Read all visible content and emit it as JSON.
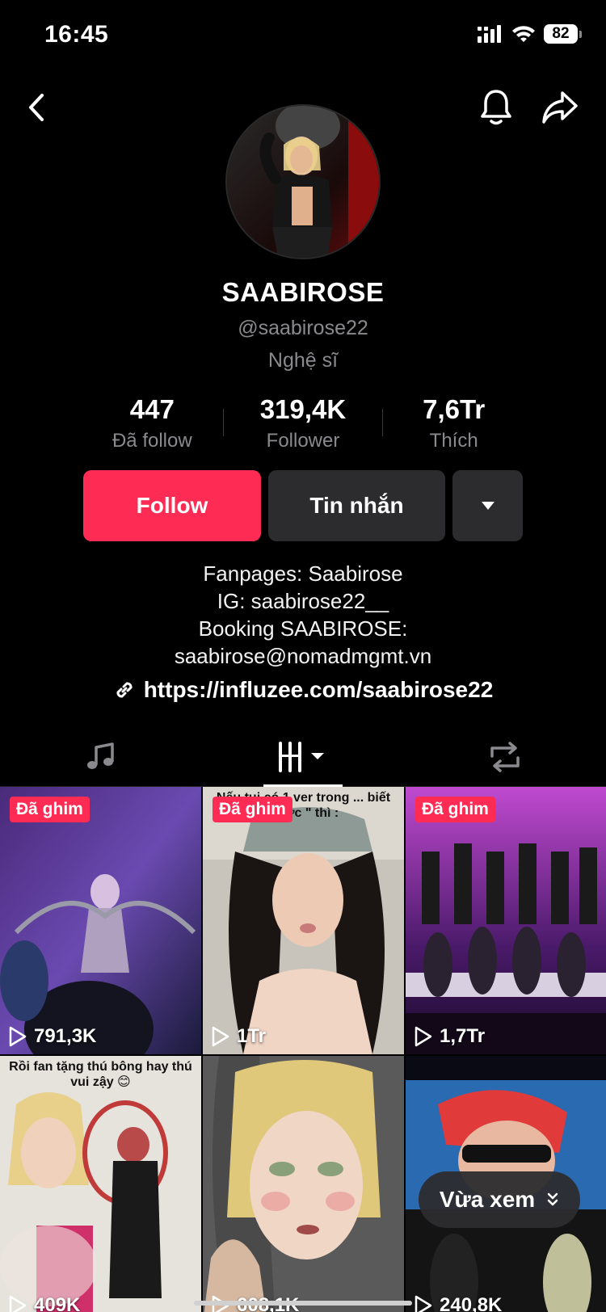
{
  "status_bar": {
    "time": "16:45",
    "battery": "82"
  },
  "nav": {
    "back_icon": "chevron-left-icon",
    "bell_icon": "bell-icon",
    "share_icon": "share-arrow-icon"
  },
  "profile": {
    "display_name": "SAABIROSE",
    "username": "@saabirose22",
    "category": "Nghệ sĩ"
  },
  "stats": [
    {
      "value": "447",
      "label": "Đã follow"
    },
    {
      "value": "319,4K",
      "label": "Follower"
    },
    {
      "value": "7,6Tr",
      "label": "Thích"
    }
  ],
  "actions": {
    "follow_label": "Follow",
    "message_label": "Tin nhắn"
  },
  "bio": {
    "lines": [
      "Fanpages: Saabirose",
      "IG: saabirose22__",
      "Booking SAABIROSE:",
      "saabirose@nomadmgmt.vn"
    ],
    "link": "https://influzee.com/saabirose22"
  },
  "tabs": [
    {
      "icon": "music-note-icon"
    },
    {
      "icon": "videos-grid-icon"
    },
    {
      "icon": "repost-icon"
    }
  ],
  "videos": [
    {
      "pinned_label": "Đã ghim",
      "views": "791,3K",
      "overlay": ""
    },
    {
      "pinned_label": "Đã ghim",
      "views": "1Tr",
      "overlay": "Nếu tui có 1 ver trong ... biết được \" thì :"
    },
    {
      "pinned_label": "Đã ghim",
      "views": "1,7Tr",
      "overlay": ""
    },
    {
      "pinned_label": "",
      "views": "409K",
      "overlay": "Rồi fan tặng thú bông hay thú vui zậy 😊"
    },
    {
      "pinned_label": "",
      "views": "608,1K",
      "overlay": ""
    },
    {
      "pinned_label": "",
      "views": "240,8K",
      "overlay": ""
    }
  ],
  "recent_pill": {
    "label": "Vừa xem"
  },
  "colors": {
    "accent": "#fe2c55",
    "background": "#000000",
    "secondary_button": "#2c2c2e",
    "muted_text": "#8a8a8e"
  }
}
